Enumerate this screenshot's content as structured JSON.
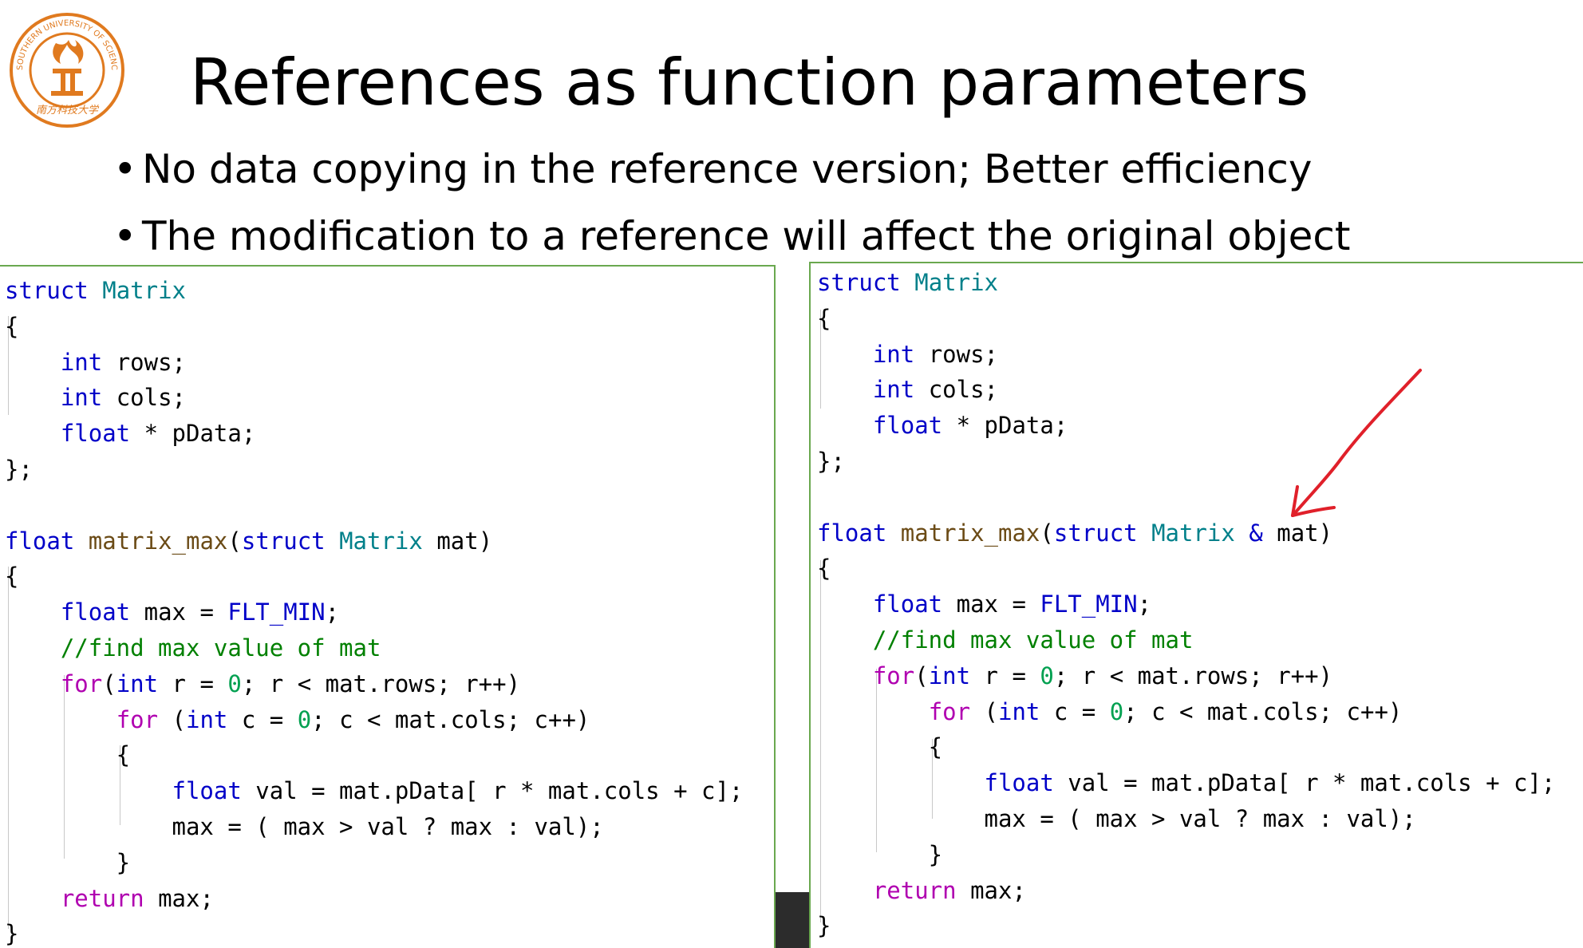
{
  "logo": {
    "ring_text": "SOUTHERN UNIVERSITY OF SCIENCE AND TECHNOLOGY",
    "chinese_text": "南方科技大学",
    "color": "#e07a1f"
  },
  "slide": {
    "title": "References as function parameters",
    "bullets": [
      "No data copying in the reference version; Better efficiency",
      "The modification to a reference will affect the original object"
    ]
  },
  "code_panels": {
    "left": {
      "lines": [
        [
          [
            "kw",
            "struct"
          ],
          [
            "p",
            " "
          ],
          [
            "ty",
            "Matrix"
          ]
        ],
        [
          [
            "p",
            "{"
          ]
        ],
        [
          [
            "p",
            "    "
          ],
          [
            "kw",
            "int"
          ],
          [
            "p",
            " rows;"
          ]
        ],
        [
          [
            "p",
            "    "
          ],
          [
            "kw",
            "int"
          ],
          [
            "p",
            " cols;"
          ]
        ],
        [
          [
            "p",
            "    "
          ],
          [
            "kw",
            "float"
          ],
          [
            "p",
            " * pData;"
          ]
        ],
        [
          [
            "p",
            "};"
          ]
        ],
        [
          [
            "p",
            ""
          ]
        ],
        [
          [
            "kw",
            "float"
          ],
          [
            "p",
            " "
          ],
          [
            "fn",
            "matrix_max"
          ],
          [
            "p",
            "("
          ],
          [
            "kw",
            "struct"
          ],
          [
            "p",
            " "
          ],
          [
            "ty",
            "Matrix"
          ],
          [
            "p",
            " mat)"
          ]
        ],
        [
          [
            "p",
            "{"
          ]
        ],
        [
          [
            "p",
            "    "
          ],
          [
            "kw",
            "float"
          ],
          [
            "p",
            " max = "
          ],
          [
            "mac",
            "FLT_MIN"
          ],
          [
            "p",
            ";"
          ]
        ],
        [
          [
            "p",
            "    "
          ],
          [
            "cm",
            "//find max value of mat"
          ]
        ],
        [
          [
            "p",
            "    "
          ],
          [
            "cf",
            "for"
          ],
          [
            "p",
            "("
          ],
          [
            "kw",
            "int"
          ],
          [
            "p",
            " r = "
          ],
          [
            "num",
            "0"
          ],
          [
            "p",
            "; r < mat.rows; r++)"
          ]
        ],
        [
          [
            "p",
            "        "
          ],
          [
            "cf",
            "for"
          ],
          [
            "p",
            " ("
          ],
          [
            "kw",
            "int"
          ],
          [
            "p",
            " c = "
          ],
          [
            "num",
            "0"
          ],
          [
            "p",
            "; c < mat.cols; c++)"
          ]
        ],
        [
          [
            "p",
            "        {"
          ]
        ],
        [
          [
            "p",
            "            "
          ],
          [
            "kw",
            "float"
          ],
          [
            "p",
            " val = mat.pData[ r * mat.cols + c];"
          ]
        ],
        [
          [
            "p",
            "            max = ( max > val ? max : val);"
          ]
        ],
        [
          [
            "p",
            "        }"
          ]
        ],
        [
          [
            "p",
            "    "
          ],
          [
            "cf",
            "return"
          ],
          [
            "p",
            " max;"
          ]
        ],
        [
          [
            "p",
            "}"
          ]
        ]
      ]
    },
    "right": {
      "lines": [
        [
          [
            "kw",
            "struct"
          ],
          [
            "p",
            " "
          ],
          [
            "ty",
            "Matrix"
          ]
        ],
        [
          [
            "p",
            "{"
          ]
        ],
        [
          [
            "p",
            "    "
          ],
          [
            "kw",
            "int"
          ],
          [
            "p",
            " rows;"
          ]
        ],
        [
          [
            "p",
            "    "
          ],
          [
            "kw",
            "int"
          ],
          [
            "p",
            " cols;"
          ]
        ],
        [
          [
            "p",
            "    "
          ],
          [
            "kw",
            "float"
          ],
          [
            "p",
            " * pData;"
          ]
        ],
        [
          [
            "p",
            "};"
          ]
        ],
        [
          [
            "p",
            ""
          ]
        ],
        [
          [
            "kw",
            "float"
          ],
          [
            "p",
            " "
          ],
          [
            "fn",
            "matrix_max"
          ],
          [
            "p",
            "("
          ],
          [
            "kw",
            "struct"
          ],
          [
            "p",
            " "
          ],
          [
            "ty",
            "Matrix"
          ],
          [
            "p",
            " "
          ],
          [
            "kw",
            "&"
          ],
          [
            "p",
            " mat)"
          ]
        ],
        [
          [
            "p",
            "{"
          ]
        ],
        [
          [
            "p",
            "    "
          ],
          [
            "kw",
            "float"
          ],
          [
            "p",
            " max = "
          ],
          [
            "mac",
            "FLT_MIN"
          ],
          [
            "p",
            ";"
          ]
        ],
        [
          [
            "p",
            "    "
          ],
          [
            "cm",
            "//find max value of mat"
          ]
        ],
        [
          [
            "p",
            "    "
          ],
          [
            "cf",
            "for"
          ],
          [
            "p",
            "("
          ],
          [
            "kw",
            "int"
          ],
          [
            "p",
            " r = "
          ],
          [
            "num",
            "0"
          ],
          [
            "p",
            "; r < mat.rows; r++)"
          ]
        ],
        [
          [
            "p",
            "        "
          ],
          [
            "cf",
            "for"
          ],
          [
            "p",
            " ("
          ],
          [
            "kw",
            "int"
          ],
          [
            "p",
            " c = "
          ],
          [
            "num",
            "0"
          ],
          [
            "p",
            "; c < mat.cols; c++)"
          ]
        ],
        [
          [
            "p",
            "        {"
          ]
        ],
        [
          [
            "p",
            "            "
          ],
          [
            "kw",
            "float"
          ],
          [
            "p",
            " val = mat.pData[ r * mat.cols + c];"
          ]
        ],
        [
          [
            "p",
            "            max = ( max > val ? max : val);"
          ]
        ],
        [
          [
            "p",
            "        }"
          ]
        ],
        [
          [
            "p",
            "    "
          ],
          [
            "cf",
            "return"
          ],
          [
            "p",
            " max;"
          ]
        ],
        [
          [
            "p",
            "}"
          ]
        ]
      ]
    }
  },
  "colors": {
    "keyword": "#0000c8",
    "type": "#00808a",
    "function": "#6b4b16",
    "control": "#b000b0",
    "comment": "#008000",
    "number": "#00a050",
    "panel_border": "#6aa84f",
    "annotation_arrow": "#e0202a"
  },
  "annotation": {
    "icon": "red-hand-drawn-arrow-icon"
  }
}
